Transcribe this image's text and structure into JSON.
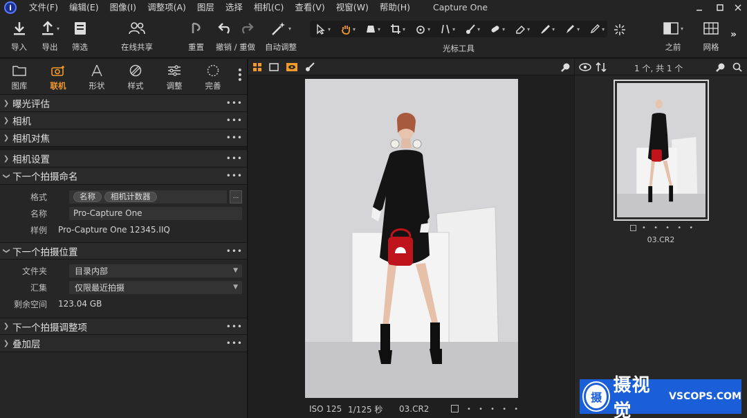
{
  "window": {
    "title": "Capture One",
    "app_logo_glyph": "i"
  },
  "menu": [
    "文件(F)",
    "编辑(E)",
    "图像(I)",
    "调整项(A)",
    "图层",
    "选择",
    "相机(C)",
    "查看(V)",
    "视窗(W)",
    "帮助(H)"
  ],
  "toolbar": {
    "import": "导入",
    "export": "导出",
    "filter": "筛选",
    "share": "在线共享",
    "reset": "重置",
    "undo_redo": "撤销 / 重做",
    "auto_adjust": "自动调整",
    "cursor_tools": "光标工具",
    "before": "之前",
    "grid": "网格",
    "accent": "#f39a2c"
  },
  "tool_tabs": [
    {
      "label": "图库",
      "icon": "folder-icon"
    },
    {
      "label": "联机",
      "icon": "camera-icon"
    },
    {
      "label": "形状",
      "icon": "lens-icon"
    },
    {
      "label": "样式",
      "icon": "styles-icon"
    },
    {
      "label": "调整",
      "icon": "sliders-icon"
    },
    {
      "label": "完善",
      "icon": "refine-icon"
    }
  ],
  "sections": {
    "exposure": "曝光评估",
    "camera": "相机",
    "focus": "相机对焦",
    "camera_settings": "相机设置",
    "naming": "下一个拍摄命名",
    "location": "下一个拍摄位置",
    "adjustments": "下一个拍摄调整项",
    "overlay": "叠加层"
  },
  "naming": {
    "format_label": "格式",
    "tokens": [
      "名称",
      "相机计数器"
    ],
    "format_button": "...",
    "name_label": "名称",
    "name_value": "Pro-Capture One",
    "sample_label": "样例",
    "sample_value": "Pro-Capture One 12345.IIQ"
  },
  "location": {
    "folder_label": "文件夹",
    "folder_value": "目录内部",
    "album_label": "汇集",
    "album_value": "仅限最近拍摄",
    "space_label": "剩余空间",
    "space_value": "123.04 GB"
  },
  "viewer": {
    "iso": "ISO 125",
    "shutter": "1/125 秒",
    "filename": "03.CR2",
    "rating_dots": "• • • • •"
  },
  "browser": {
    "count": "1 个, 共 1 个",
    "thumb_name": "03.CR2",
    "rating_dots": "• • • • •"
  },
  "watermark": {
    "text": "摄视觉",
    "domain": "VSCOPS.COM",
    "seal": "摄",
    "color": "#1a5ed8"
  }
}
